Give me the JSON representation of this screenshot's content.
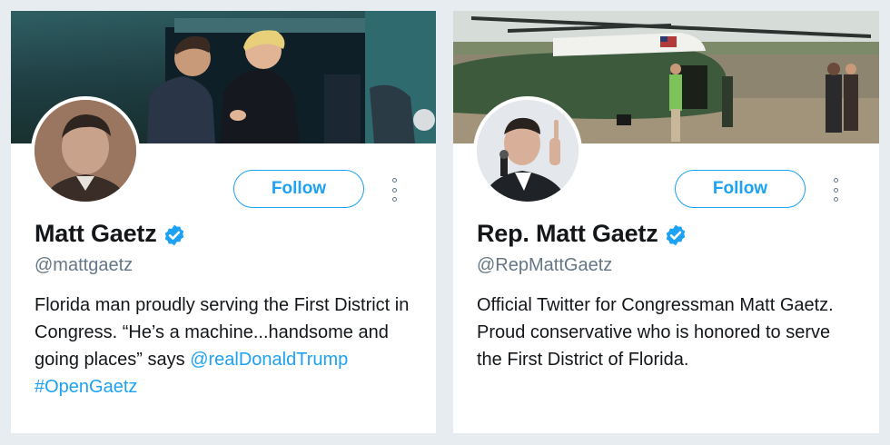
{
  "colors": {
    "accent": "#1da1f2",
    "text_primary": "#14171a",
    "text_secondary": "#657786",
    "page_background": "#e6ecf0",
    "card_background": "#ffffff"
  },
  "profiles": [
    {
      "name": "Matt Gaetz",
      "verified_icon": "verified-badge-icon",
      "handle": "@mattgaetz",
      "follow_label": "Follow",
      "more_icon": "vertical-ellipsis-icon",
      "bio_text_1": "Florida man proudly serving the First District in Congress. “He’s a machine...handsome and going places” says ",
      "bio_mention": "@realDonaldTrump",
      "bio_space": " ",
      "bio_hashtag": "#OpenGaetz"
    },
    {
      "name": "Rep. Matt Gaetz",
      "verified_icon": "verified-badge-icon",
      "handle": "@RepMattGaetz",
      "follow_label": "Follow",
      "more_icon": "vertical-ellipsis-icon",
      "bio_text_1": "Official Twitter for Congressman Matt Gaetz. Proud conservative who is honored to serve the First District of Florida."
    }
  ]
}
